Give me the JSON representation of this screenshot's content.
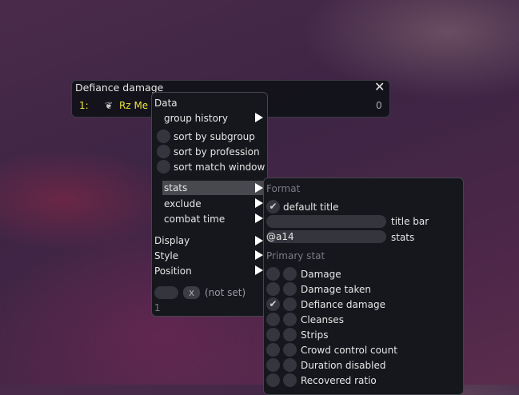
{
  "window": {
    "title": "Defiance damage",
    "close_icon": "close-icon",
    "row": {
      "rank": "1:",
      "profession_icon": "profession-icon",
      "name": "Rz Me",
      "value": "0"
    },
    "accent": "#e8e23a"
  },
  "menu": {
    "data_header": "Data",
    "group_history": "group history",
    "sort_options": [
      {
        "label": "sort by subgroup",
        "checked": false
      },
      {
        "label": "sort by profession",
        "checked": false
      },
      {
        "label": "sort match window",
        "checked": false
      }
    ],
    "stats": "stats",
    "exclude": "exclude",
    "combat_time": "combat time",
    "display": "Display",
    "style": "Style",
    "position": "Position",
    "clear_button": "x",
    "not_set": "(not set)",
    "index": "1"
  },
  "submenu": {
    "format_header": "Format",
    "default_title": {
      "label": "default title",
      "checked": true
    },
    "title_bar": {
      "label": "title bar",
      "value": ""
    },
    "stats_field": {
      "label": "stats",
      "value": "@a14"
    },
    "primary_header": "Primary stat",
    "stats": [
      {
        "label": "Damage",
        "checked": false
      },
      {
        "label": "Damage taken",
        "checked": false
      },
      {
        "label": "Defiance damage",
        "checked": true
      },
      {
        "label": "Cleanses",
        "checked": false
      },
      {
        "label": "Strips",
        "checked": false
      },
      {
        "label": "Crowd control count",
        "checked": false
      },
      {
        "label": "Duration disabled",
        "checked": false
      },
      {
        "label": "Recovered ratio",
        "checked": false
      }
    ]
  }
}
